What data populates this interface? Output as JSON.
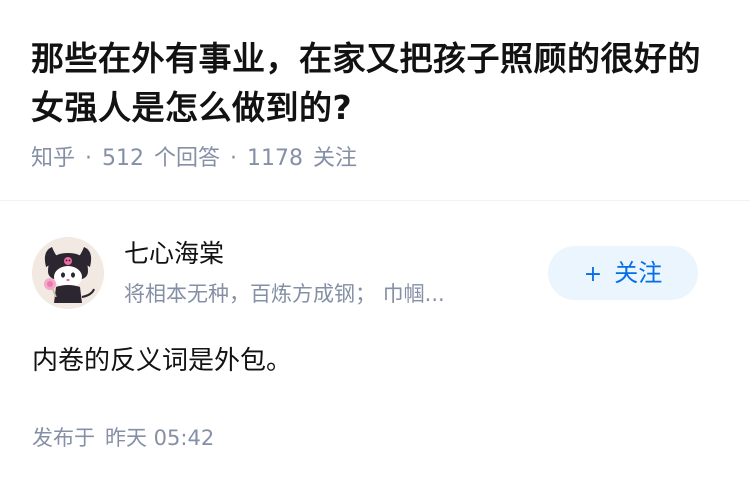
{
  "question": {
    "title": "那些在外有事业，在家又把孩子照顾的很好的女强人是怎么做到的?",
    "source": "知乎",
    "separator": "·",
    "answer_count": "512",
    "answer_label": "个回答",
    "follower_count": "1178",
    "follower_label": "关注"
  },
  "author": {
    "avatar_icon": "kuromi-avatar-icon",
    "name": "七心海棠",
    "bio": "将相本无种，百炼方成钢； 巾帼...",
    "follow_plus": "+",
    "follow_label": "关注"
  },
  "answer": {
    "text": "内卷的反义词是外包。",
    "published_label": "发布于",
    "published_time": "昨天 05:42"
  },
  "colors": {
    "title": "#121212",
    "meta": "#8590a6",
    "accent": "#056de8",
    "follow_bg": "#ebf5fd"
  }
}
